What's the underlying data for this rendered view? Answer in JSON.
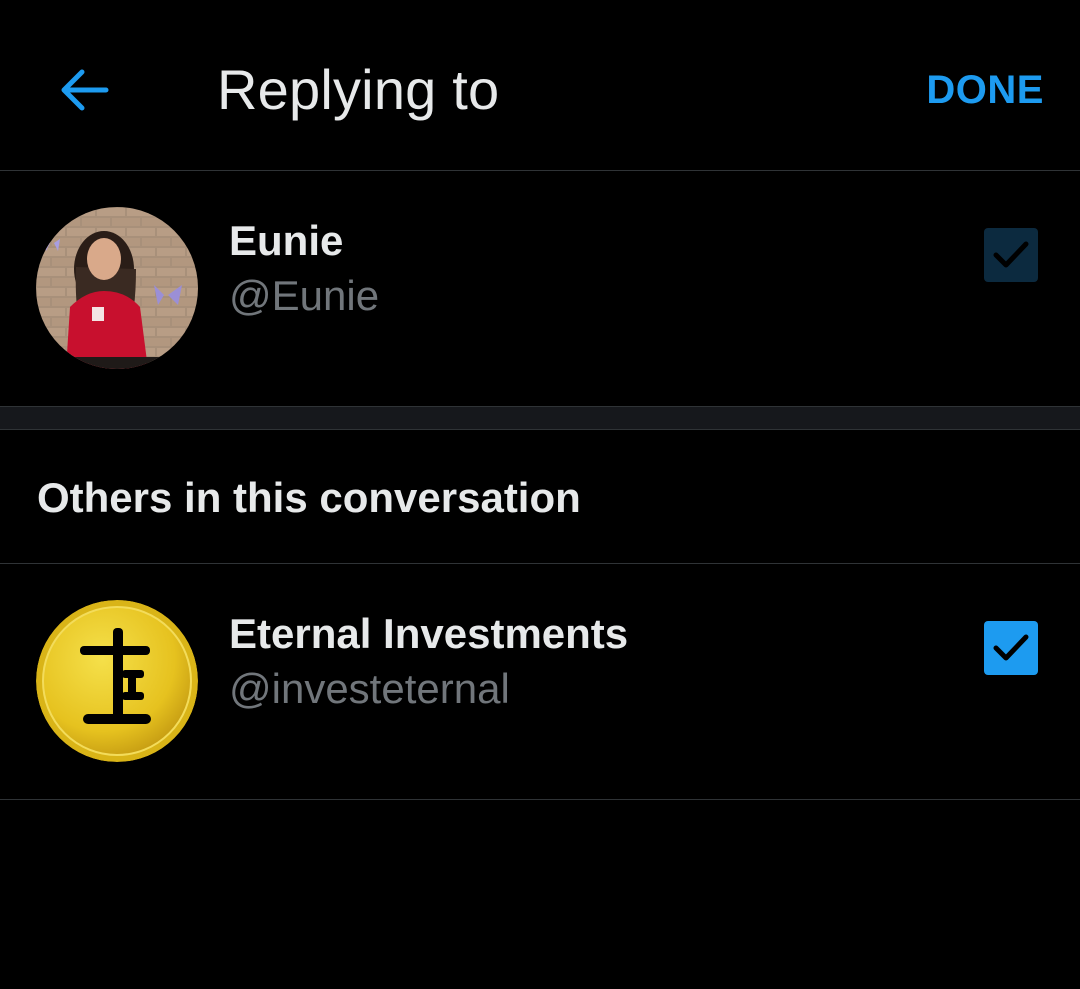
{
  "header": {
    "title": "Replying to",
    "done_label": "DONE",
    "back_icon": "arrow-left-icon"
  },
  "colors": {
    "accent": "#1d9bf0",
    "background": "#000000",
    "muted_checkbox": "#0c2a3f",
    "secondary_text": "#71767b"
  },
  "primary": {
    "name": "Eunie",
    "handle": "@Eunie",
    "checked": true
  },
  "others": {
    "section_title": "Others in this conversation",
    "users": [
      {
        "name": "Eternal Investments",
        "handle": "@investeternal",
        "checked": true
      }
    ]
  }
}
